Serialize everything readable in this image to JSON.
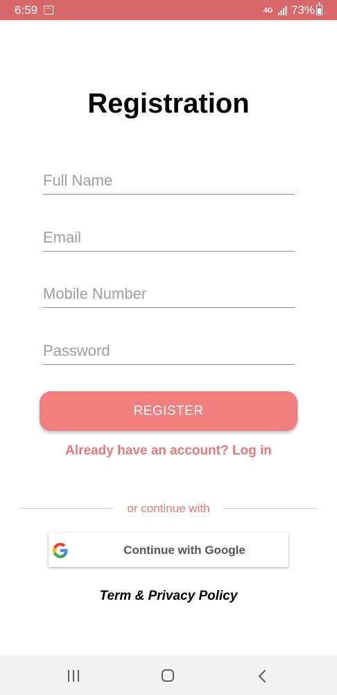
{
  "status_bar": {
    "time": "6:59",
    "network": "4G",
    "battery_percent": "73%",
    "icons": [
      "notification-icon",
      "signal-icon",
      "battery-icon"
    ]
  },
  "title": "Registration",
  "form": {
    "full_name_placeholder": "Full Name",
    "email_placeholder": "Email",
    "mobile_placeholder": "Mobile Number",
    "password_placeholder": "Password",
    "register_label": "REGISTER"
  },
  "login_prompt": "Already have an account? Log in",
  "divider_text": "or continue with",
  "google_button_label": "Continue with Google",
  "policy_link": "Term & Privacy Policy",
  "colors": {
    "status_bar": "#d9686b",
    "accent": "#e27a7c",
    "register_button": "#f17f7f"
  },
  "nav_bar": {
    "icons": [
      "recent-apps-icon",
      "home-icon",
      "back-icon"
    ]
  }
}
